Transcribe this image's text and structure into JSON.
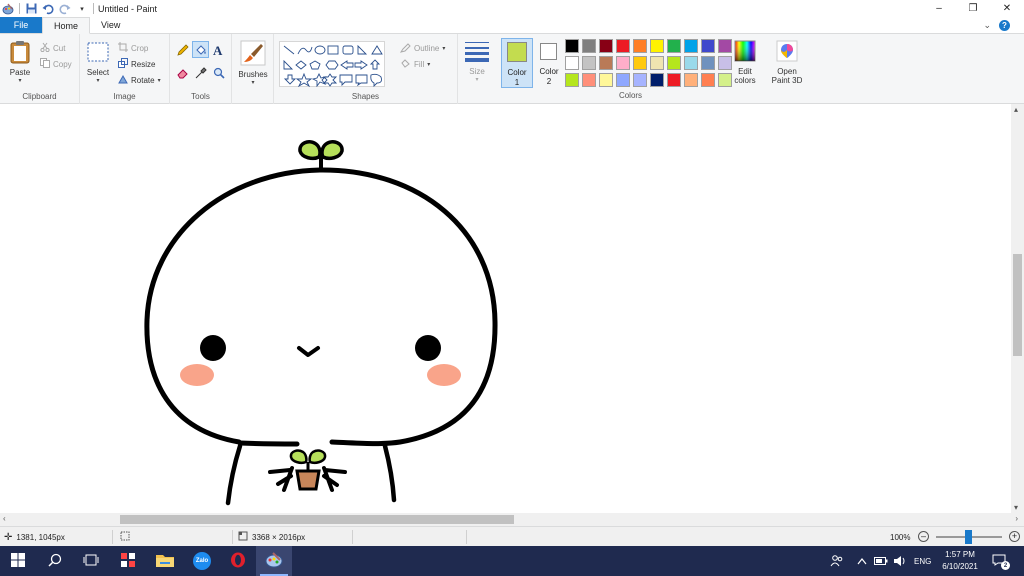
{
  "window": {
    "title": "Untitled - Paint",
    "controls": {
      "minimize": "–",
      "maximize": "❐",
      "close": "✕"
    }
  },
  "tabs": [
    "File",
    "Home",
    "View"
  ],
  "ribbon": {
    "clipboard": {
      "label": "Clipboard",
      "paste": "Paste",
      "cut": "Cut",
      "copy": "Copy"
    },
    "image": {
      "label": "Image",
      "select": "Select",
      "crop": "Crop",
      "resize": "Resize",
      "rotate": "Rotate"
    },
    "tools": {
      "label": "Tools"
    },
    "brushes": {
      "label": "Brushes"
    },
    "shapes": {
      "label": "Shapes",
      "outline": "Outline",
      "fill": "Fill"
    },
    "size": {
      "label": "Size"
    },
    "color1": {
      "label": "Color",
      "num": "1",
      "value": "#c3dc4f"
    },
    "color2": {
      "label": "Color",
      "num": "2",
      "value": "#ffffff"
    },
    "colors": {
      "label": "Colors",
      "palette": [
        "#000000",
        "#7f7f7f",
        "#880015",
        "#ed1c24",
        "#ff7f27",
        "#fff200",
        "#22b14c",
        "#00a2e8",
        "#3f48cc",
        "#a349a4",
        "#ffffff",
        "#c3c3c3",
        "#b97a57",
        "#ffaec9",
        "#ffc90e",
        "#efe4b0",
        "#b5e61d",
        "#99d9ea",
        "#7092be",
        "#c8bfe7",
        "#b5e61d",
        "#ff8f7a",
        "#fff799",
        "#8fa8ff",
        "#a6b4ff",
        "#001f6b",
        "#ed1c24",
        "#ffb07a",
        "#ff7f50",
        "#d4f08a"
      ]
    },
    "edit_colors": {
      "line1": "Edit",
      "line2": "colors"
    },
    "paint3d": {
      "line1": "Open",
      "line2": "Paint 3D"
    }
  },
  "status": {
    "cursor": "1381, 1045px",
    "size": "3368 × 2016px",
    "zoom": "100%"
  },
  "taskbar": {
    "language": "ENG",
    "time": "1:57 PM",
    "date": "6/10/2021",
    "notifications": "2",
    "zalo": "Zalo"
  },
  "icons": {
    "paste": "clipboard-icon",
    "select": "select-rectangle-icon",
    "brush": "brush-icon",
    "start": "windows-icon",
    "search": "search-icon"
  }
}
